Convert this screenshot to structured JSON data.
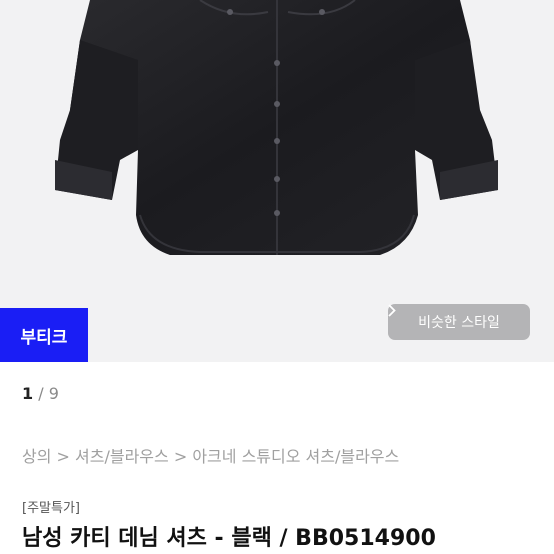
{
  "product": {
    "badge": "부티크",
    "similar_style_button": "비슷한 스타일",
    "image_counter": {
      "current": "1",
      "separator": " / ",
      "total": "9"
    },
    "breadcrumb": [
      "상의",
      "셔츠/블라우스",
      "아크네 스튜디오 셔츠/블라우스"
    ],
    "breadcrumb_separator": " > ",
    "promo_tag": "[주말특가]",
    "title": "남성 카티 데님 셔츠 - 블랙 / BB0514900"
  },
  "icons": {
    "chevron": "chevron-right-icon"
  },
  "colors": {
    "badge_bg": "#1a1ef5",
    "button_bg": "#b4b4b6",
    "hero_bg": "#f2f2f3"
  }
}
